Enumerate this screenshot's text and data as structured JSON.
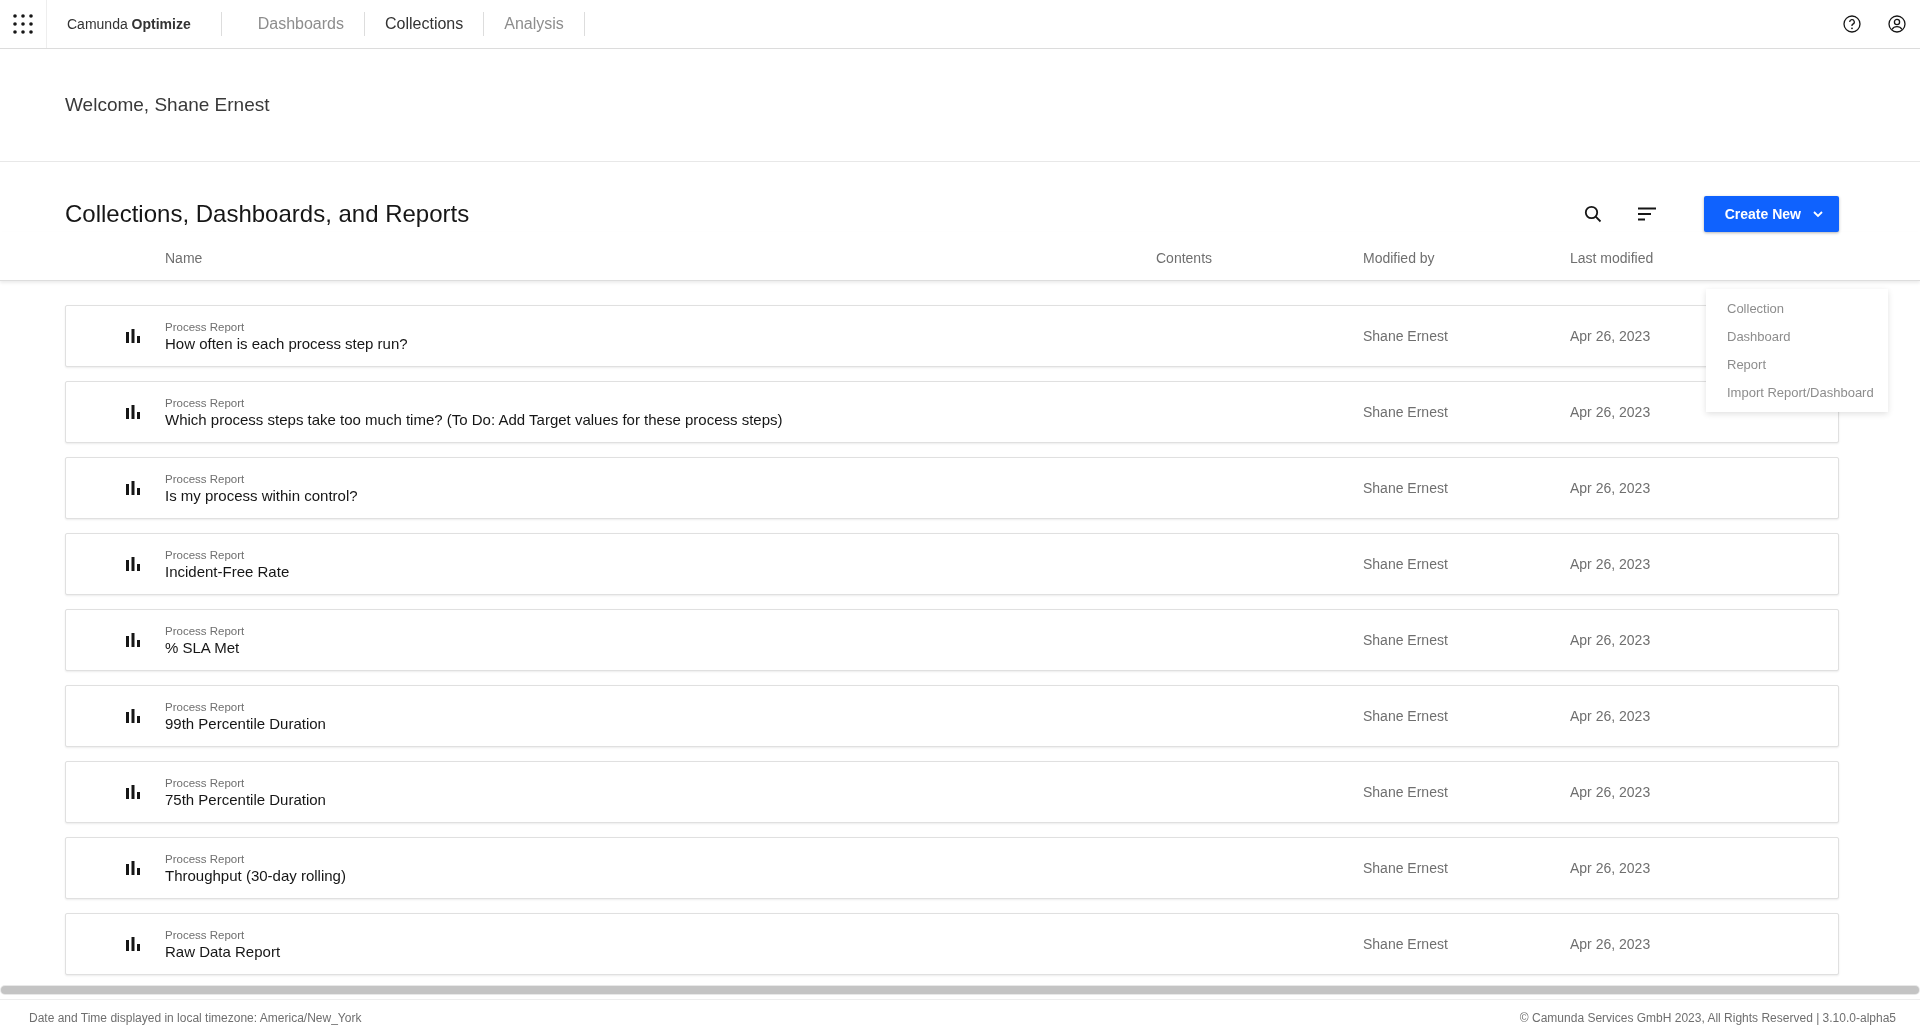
{
  "brand": "Camunda **Optimize**",
  "nav": [
    {
      "label": "Dashboards",
      "selected": false
    },
    {
      "label": "Collections",
      "selected": true
    },
    {
      "label": "Analysis",
      "selected": false
    }
  ],
  "welcome": "Welcome, Shane Ernest",
  "section_title": "Collections, Dashboards, and Reports",
  "create_button": "Create New",
  "create_menu": [
    "Collection",
    "Dashboard",
    "Report",
    "Import Report/Dashboard"
  ],
  "columns": [
    "Name",
    "Contents",
    "Modified by",
    "Last modified"
  ],
  "rows": [
    {
      "type": "Process Report",
      "name": "How often is each process step run?",
      "modified_by": "Shane Ernest",
      "last_modified": "Apr 26, 2023"
    },
    {
      "type": "Process Report",
      "name": "Which process steps take too much time? (To Do: Add Target values for these process steps)",
      "modified_by": "Shane Ernest",
      "last_modified": "Apr 26, 2023"
    },
    {
      "type": "Process Report",
      "name": "Is my process within control?",
      "modified_by": "Shane Ernest",
      "last_modified": "Apr 26, 2023"
    },
    {
      "type": "Process Report",
      "name": "Incident-Free Rate",
      "modified_by": "Shane Ernest",
      "last_modified": "Apr 26, 2023"
    },
    {
      "type": "Process Report",
      "name": "% SLA Met",
      "modified_by": "Shane Ernest",
      "last_modified": "Apr 26, 2023"
    },
    {
      "type": "Process Report",
      "name": "99th Percentile Duration",
      "modified_by": "Shane Ernest",
      "last_modified": "Apr 26, 2023"
    },
    {
      "type": "Process Report",
      "name": "75th Percentile Duration",
      "modified_by": "Shane Ernest",
      "last_modified": "Apr 26, 2023"
    },
    {
      "type": "Process Report",
      "name": "Throughput (30-day rolling)",
      "modified_by": "Shane Ernest",
      "last_modified": "Apr 26, 2023"
    },
    {
      "type": "Process Report",
      "name": "Raw Data Report",
      "modified_by": "Shane Ernest",
      "last_modified": "Apr 26, 2023"
    }
  ],
  "footer": {
    "timezone": "Date and Time displayed in local timezone: America/New_York",
    "copyright": "© Camunda Services GmbH 2023, All Rights Reserved | 3.10.0-alpha5"
  }
}
